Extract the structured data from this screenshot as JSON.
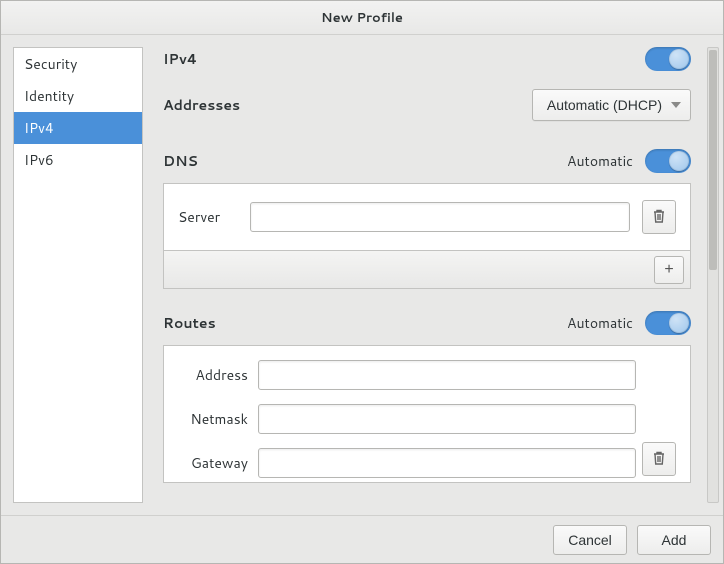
{
  "window": {
    "title": "New Profile"
  },
  "sidebar": {
    "items": [
      {
        "label": "Security",
        "selected": false
      },
      {
        "label": "Identity",
        "selected": false
      },
      {
        "label": "IPv4",
        "selected": true
      },
      {
        "label": "IPv6",
        "selected": false
      }
    ]
  },
  "ipv4": {
    "heading": "IPv4",
    "enabled": true,
    "addresses": {
      "label": "Addresses",
      "selected": "Automatic (DHCP)"
    },
    "dns": {
      "heading": "DNS",
      "auto_label": "Automatic",
      "auto": true,
      "server_label": "Server",
      "server_value": ""
    },
    "routes": {
      "heading": "Routes",
      "auto_label": "Automatic",
      "auto": true,
      "fields": {
        "address_label": "Address",
        "address_value": "",
        "netmask_label": "Netmask",
        "netmask_value": "",
        "gateway_label": "Gateway",
        "gateway_value": ""
      }
    }
  },
  "footer": {
    "cancel": "Cancel",
    "add": "Add"
  },
  "icons": {
    "trash": "trash-icon",
    "plus": "+",
    "caret": "▾"
  }
}
